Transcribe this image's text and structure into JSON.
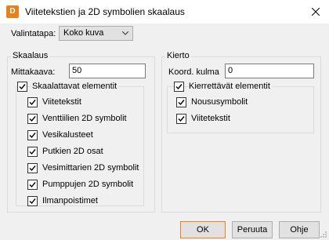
{
  "window": {
    "title": "Viitetekstien ja 2D symbolien skaalaus",
    "icon_letter": "D"
  },
  "selection": {
    "label": "Valintatapa:",
    "value": "Koko kuva"
  },
  "scaling": {
    "group_label": "Skaalaus",
    "scale_label": "Mittakaava:",
    "scale_value": "50",
    "elements_label": "Skaalattavat elementit",
    "items": [
      {
        "label": "Viitetekstit",
        "checked": true
      },
      {
        "label": "Venttiilien 2D symbolit",
        "checked": true
      },
      {
        "label": "Vesikalusteet",
        "checked": true
      },
      {
        "label": "Putkien 2D osat",
        "checked": true
      },
      {
        "label": "Vesimittarien 2D symbolit",
        "checked": true
      },
      {
        "label": "Pumppujen 2D symbolit",
        "checked": true
      },
      {
        "label": "Ilmanpoistimet",
        "checked": true
      }
    ]
  },
  "rotation": {
    "group_label": "Kierto",
    "angle_label": "Koord. kulma",
    "angle_value": "0",
    "elements_label": "Kierrettävät elementit",
    "items": [
      {
        "label": "Noususymbolit",
        "checked": true
      },
      {
        "label": "Viitetekstit",
        "checked": true
      }
    ]
  },
  "buttons": {
    "ok": "OK",
    "cancel": "Peruuta",
    "help": "Ohje"
  },
  "colors": {
    "accent": "#e8811c"
  }
}
